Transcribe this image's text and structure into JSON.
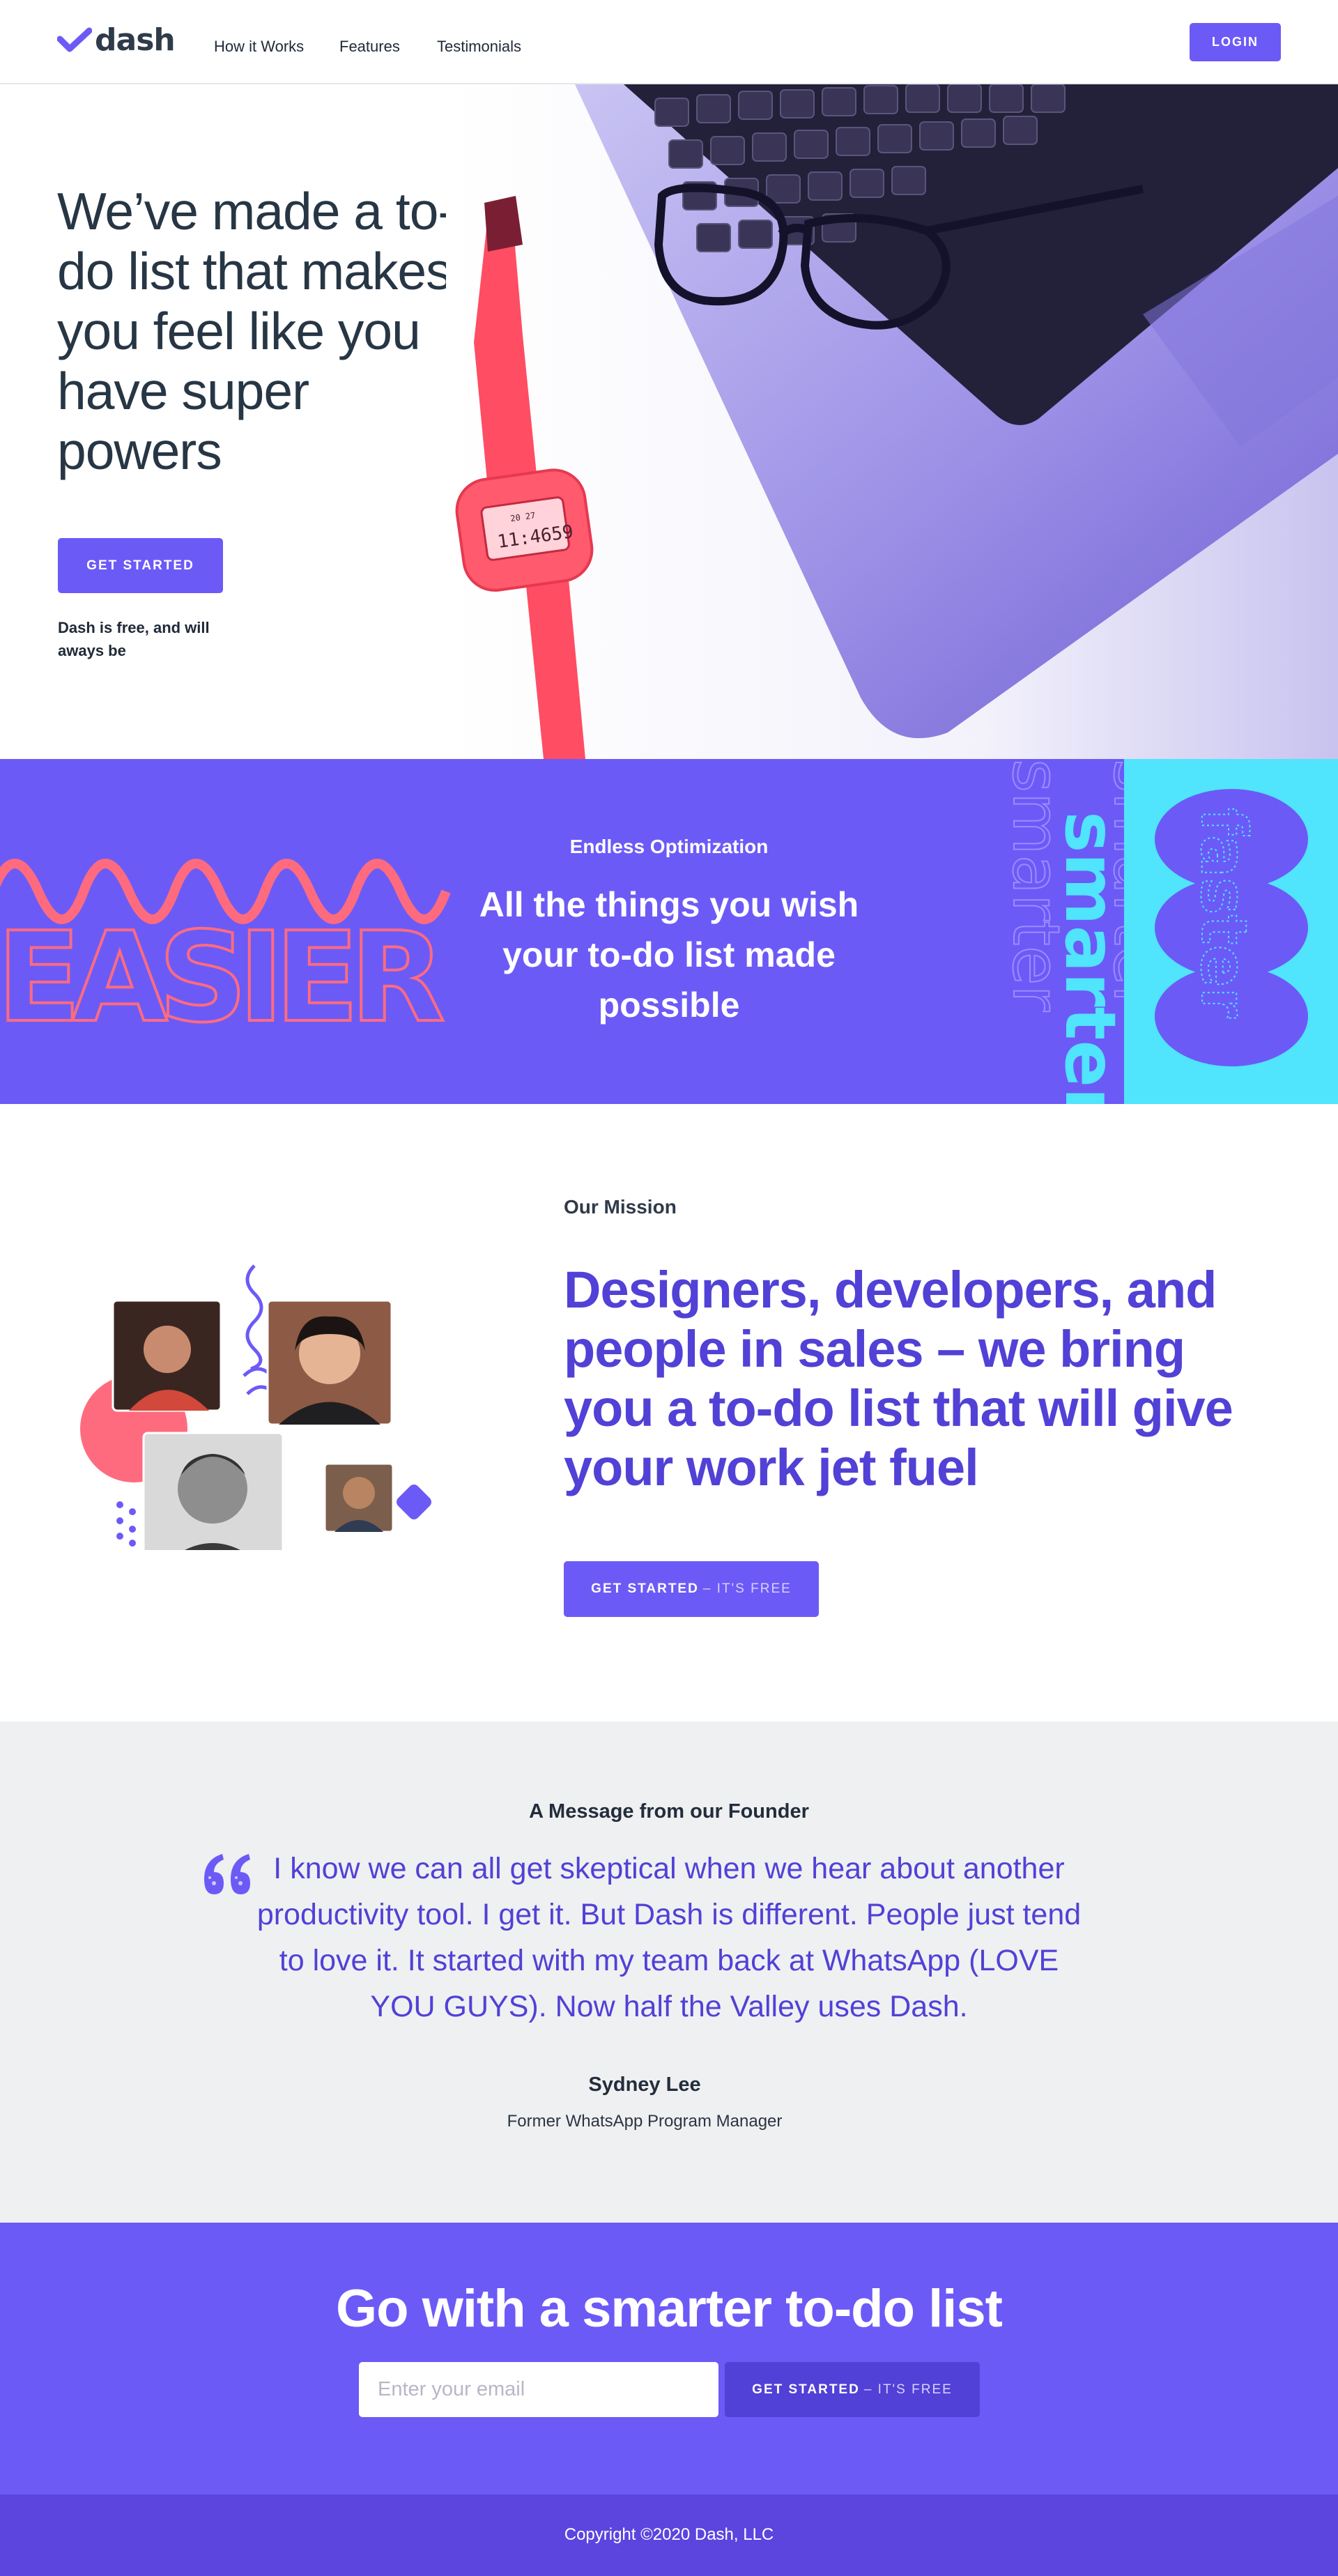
{
  "nav": {
    "logo_text": "dash",
    "links": [
      "How it Works",
      "Features",
      "Testimonials"
    ],
    "login_label": "LOGIN"
  },
  "hero": {
    "title": "We’ve made a to-do list that makes you feel like you have super powers",
    "cta_label": "GET STARTED",
    "note": "Dash is free, and will aways be",
    "watch_time": "11:4659",
    "watch_small": "20  27"
  },
  "features": {
    "eyebrow": "Endless Optimization",
    "title": "All the things you wish your to-do list made possible",
    "art_words": [
      "EASIER",
      "smarter",
      "faster"
    ]
  },
  "mission": {
    "eyebrow": "Our Mission",
    "title": "Designers, developers, and people in sales – we bring you a to-do list that will give your work jet fuel",
    "cta_strong": "GET STARTED",
    "cta_light": "– IT'S FREE"
  },
  "founder": {
    "eyebrow": "A Message from our Founder",
    "quote": "I know we can all get skeptical when we hear about another productivity tool. I get it. But Dash is different. People just tend to love it. It started with my team back at WhatsApp (LOVE YOU GUYS). Now half the Valley uses Dash.",
    "name": "Sydney Lee",
    "role": "Former WhatsApp Program Manager"
  },
  "cta": {
    "title": "Go with a smarter to-do list",
    "email_placeholder": "Enter your email",
    "button_strong": "GET STARTED",
    "button_light": "– IT'S FREE"
  },
  "footer": {
    "copyright": "Copyright ©2020 Dash, LLC"
  },
  "colors": {
    "brand": "#6c5af7",
    "brand_dark": "#5141d6",
    "accent_pink": "#fe6b7f",
    "accent_cyan": "#50e4fd",
    "text_dark": "#273645"
  },
  "icons": [
    "checkmark-logo-icon",
    "quote-icon"
  ]
}
